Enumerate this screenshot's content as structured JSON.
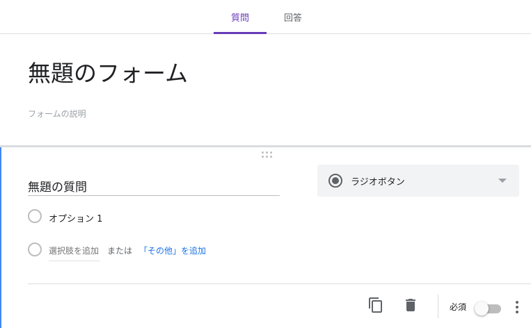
{
  "tabs": {
    "questions": "質問",
    "responses": "回答"
  },
  "form": {
    "title": "無題のフォーム",
    "description_placeholder": "フォームの説明"
  },
  "question": {
    "title": "無題の質問",
    "type_label": "ラジオボタン",
    "type_icon": "radio-button-icon",
    "option_1": "オプション 1",
    "add_option": "選択肢を追加",
    "or_text": "または",
    "add_other": "「その他」を追加",
    "required_label": "必須",
    "required": false
  },
  "icons": {
    "copy": "copy-icon",
    "delete": "trash-icon",
    "more": "more-vert-icon",
    "dropdown": "chevron-down-icon",
    "drag": "drag-handle-icon"
  },
  "colors": {
    "accent": "#673ab7",
    "card_left_border": "#4285f4",
    "link": "#1a73e8"
  }
}
